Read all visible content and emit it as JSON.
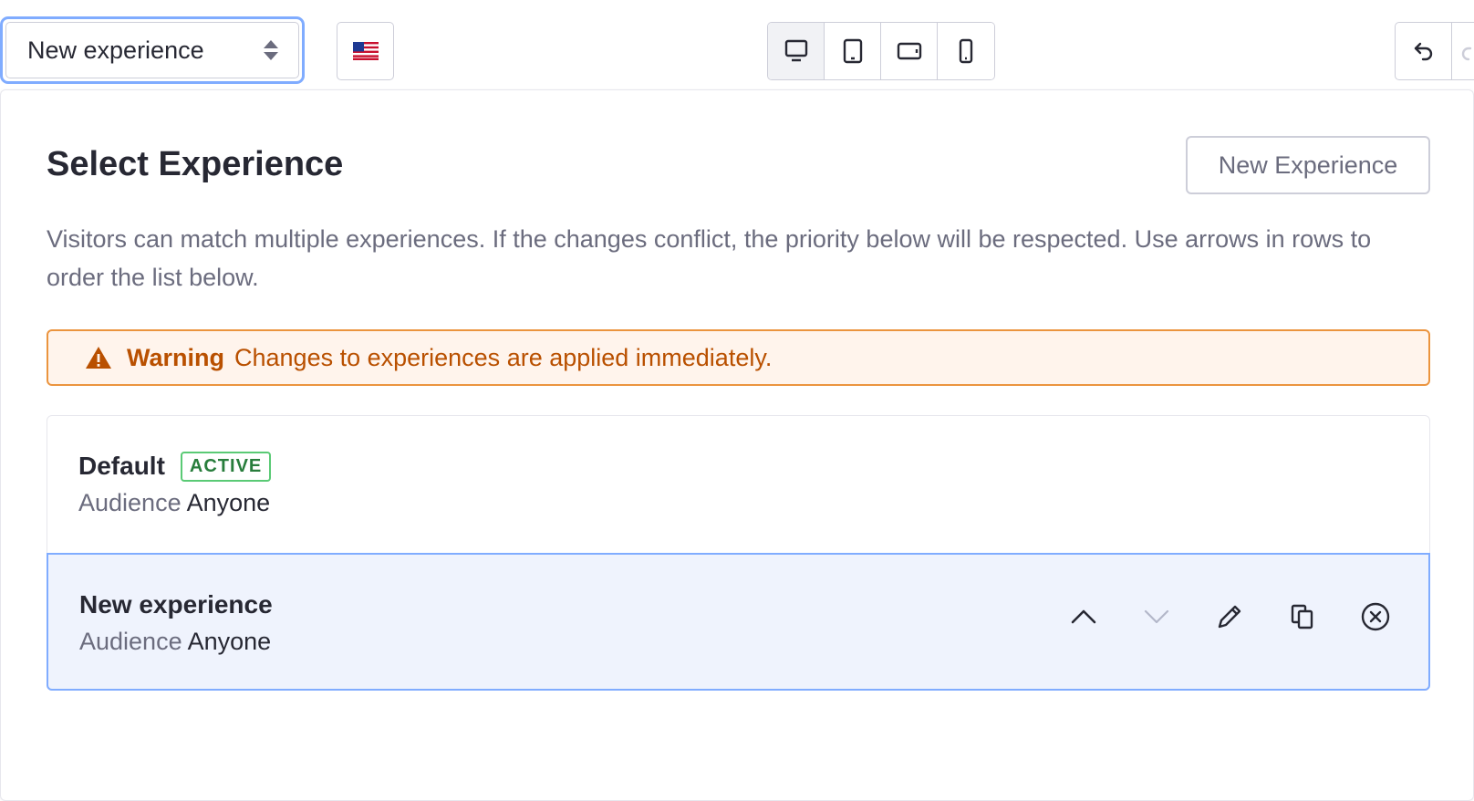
{
  "toolbar": {
    "experience_select_value": "New experience",
    "flag_icon": "us-flag-icon",
    "devices": [
      {
        "name": "desktop",
        "active": true
      },
      {
        "name": "tablet",
        "active": false
      },
      {
        "name": "tablet-landscape",
        "active": false
      },
      {
        "name": "mobile",
        "active": false
      }
    ]
  },
  "panel": {
    "title": "Select Experience",
    "new_experience_button": "New Experience",
    "description": "Visitors can match multiple experiences. If the changes conflict, the priority below will be respected. Use arrows in rows to order the list below.",
    "warning": {
      "label": "Warning",
      "message": "Changes to experiences are applied immediately."
    },
    "experiences": [
      {
        "name": "Default",
        "badge": "ACTIVE",
        "audience_label": "Audience",
        "audience_value": "Anyone"
      },
      {
        "name": "New experience",
        "audience_label": "Audience",
        "audience_value": "Anyone"
      }
    ]
  },
  "colors": {
    "accent": "#80acff",
    "warning_bg": "#fff4ec",
    "warning_text": "#b95000",
    "active_badge": "#287d3c",
    "selected_row_bg": "#eff3fd"
  }
}
